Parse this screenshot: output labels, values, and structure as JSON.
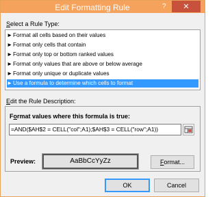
{
  "window": {
    "title": "Edit Formatting Rule",
    "help": "?",
    "close": "✕"
  },
  "rule_type_label": {
    "before": "",
    "mnemonic": "S",
    "after": "elect a Rule Type:"
  },
  "rules": [
    "Format all cells based on their values",
    "Format only cells that contain",
    "Format only top or bottom ranked values",
    "Format only values that are above or below average",
    "Format only unique or duplicate values",
    "Use a formula to determine which cells to format"
  ],
  "selected_rule_index": 5,
  "rule_bullet": "►",
  "description_label": {
    "before": "",
    "mnemonic": "E",
    "after": "dit the Rule Description:"
  },
  "formula_label": {
    "before": "F",
    "mnemonic": "o",
    "after": "rmat values where this formula is true:"
  },
  "formula_value": "=AND($AH$2 = CELL(\"col\";A1);$AH$3 = CELL(\"row\";A1))",
  "preview_label": "Preview:",
  "preview_text": "AaBbCcYyZz",
  "format_button": {
    "before": "",
    "mnemonic": "F",
    "after": "ormat..."
  },
  "ok_button": "OK",
  "cancel_button": "Cancel"
}
